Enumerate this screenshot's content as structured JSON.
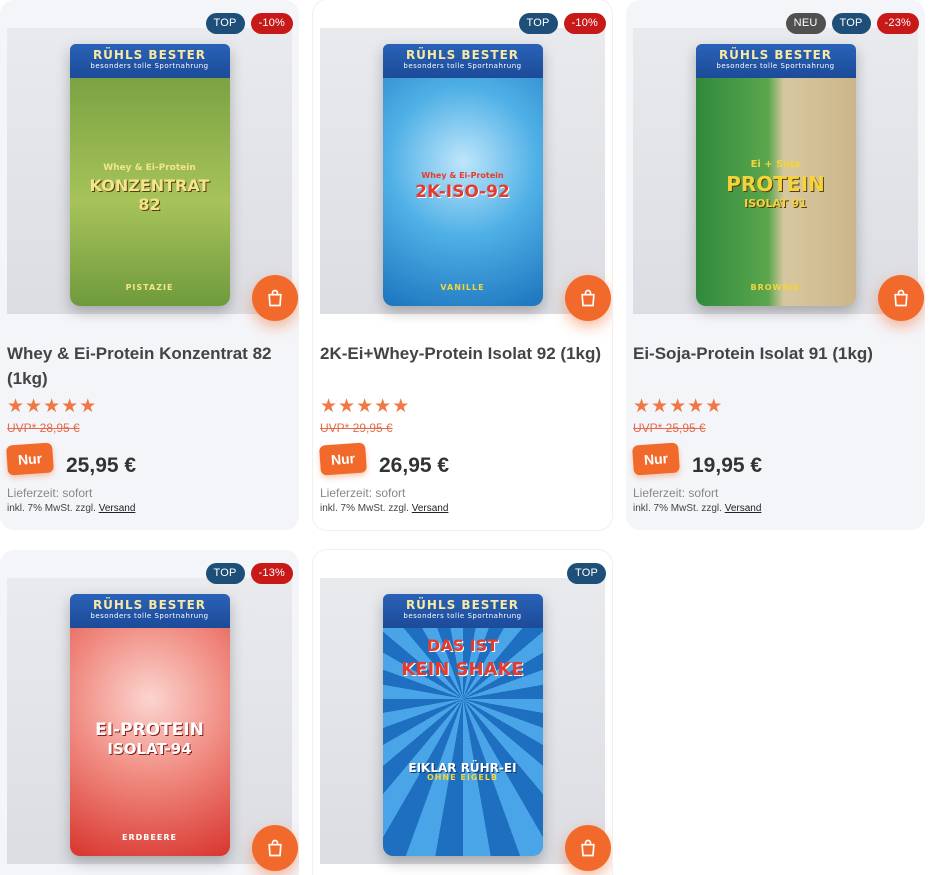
{
  "products": [
    {
      "badges": [
        {
          "text": "TOP",
          "kind": "top"
        },
        {
          "text": "-10%",
          "kind": "sale"
        }
      ],
      "name": "Whey & Ei-Protein Konzentrat 82 (1kg)",
      "rating": 5,
      "uvp": "UVP* 28,95 €",
      "nur": "Nur",
      "price": "25,95 €",
      "delivery": "Lieferzeit: sofort",
      "tax_text": "inkl. 7% MwSt. zzgl.",
      "shipping_link": "Versand",
      "pack": {
        "brand": "RÜHLS BESTER",
        "tagline": "besonders tolle Sportnahrung",
        "title_line1": "Whey & Ei-Protein",
        "title_line2": "KONZENTRAT",
        "title_line3": "82",
        "flavor": "PISTAZIE",
        "bg": "#6f9a3c",
        "bg2": "#a7c35a",
        "title_color": "#f3e58a"
      }
    },
    {
      "badges": [
        {
          "text": "TOP",
          "kind": "top"
        },
        {
          "text": "-10%",
          "kind": "sale"
        }
      ],
      "name": "2K-Ei+Whey-Protein Isolat 92 (1kg)",
      "rating": 5,
      "uvp": "UVP* 29,95 €",
      "nur": "Nur",
      "price": "26,95 €",
      "delivery": "Lieferzeit: sofort",
      "tax_text": "inkl. 7% MwSt. zzgl.",
      "shipping_link": "Versand",
      "pack": {
        "brand": "RÜHLS BESTER",
        "tagline": "besonders tolle Sportnahrung",
        "title_line1": "Whey & Ei-Protein",
        "title_line2": "2K-ISO-92",
        "title_line3": "",
        "flavor": "VANILLE",
        "bg": "#1f86c9",
        "bg2": "#7cc7ef",
        "title_color": "#e63a2e"
      }
    },
    {
      "badges": [
        {
          "text": "NEU",
          "kind": "neu"
        },
        {
          "text": "TOP",
          "kind": "top"
        },
        {
          "text": "-23%",
          "kind": "sale"
        }
      ],
      "name": "Ei-Soja-Protein Isolat 91 (1kg)",
      "rating": 5,
      "uvp": "UVP* 25,95 €",
      "nur": "Nur",
      "price": "19,95 €",
      "delivery": "Lieferzeit: sofort",
      "tax_text": "inkl. 7% MwSt. zzgl.",
      "shipping_link": "Versand",
      "pack": {
        "brand": "RÜHLS BESTER",
        "tagline": "besonders tolle Sportnahrung",
        "title_line1": "Ei + Soja",
        "title_line2": "PROTEIN",
        "title_line3": "ISOLAT 91",
        "flavor": "BROWNIE",
        "bg": "#2f8a3c",
        "bg2": "#d7c7a0",
        "title_color": "#f3d53a"
      }
    },
    {
      "badges": [
        {
          "text": "TOP",
          "kind": "top"
        },
        {
          "text": "-13%",
          "kind": "sale"
        }
      ],
      "pack": {
        "brand": "RÜHLS BESTER",
        "tagline": "besonders tolle Sportnahrung",
        "title_line1": "EI-PROTEIN",
        "title_line2": "ISOLAT-94",
        "title_line3": "",
        "flavor": "ERDBEERE",
        "bg": "#e2473f",
        "bg2": "#f7a39a",
        "title_color": "#ffffff"
      }
    },
    {
      "badges": [
        {
          "text": "TOP",
          "kind": "top"
        }
      ],
      "pack": {
        "brand": "RÜHLS BESTER",
        "tagline": "besonders tolle Sportnahrung",
        "title_line1": "DAS IST",
        "title_line2": "KEIN SHAKE",
        "title_line3": "EIKLAR RÜHR-EI",
        "flavor": "OHNE EIGELB",
        "bg": "#1f6fc0",
        "bg2": "#4aa4e8",
        "title_color": "#e63a2e"
      }
    }
  ]
}
